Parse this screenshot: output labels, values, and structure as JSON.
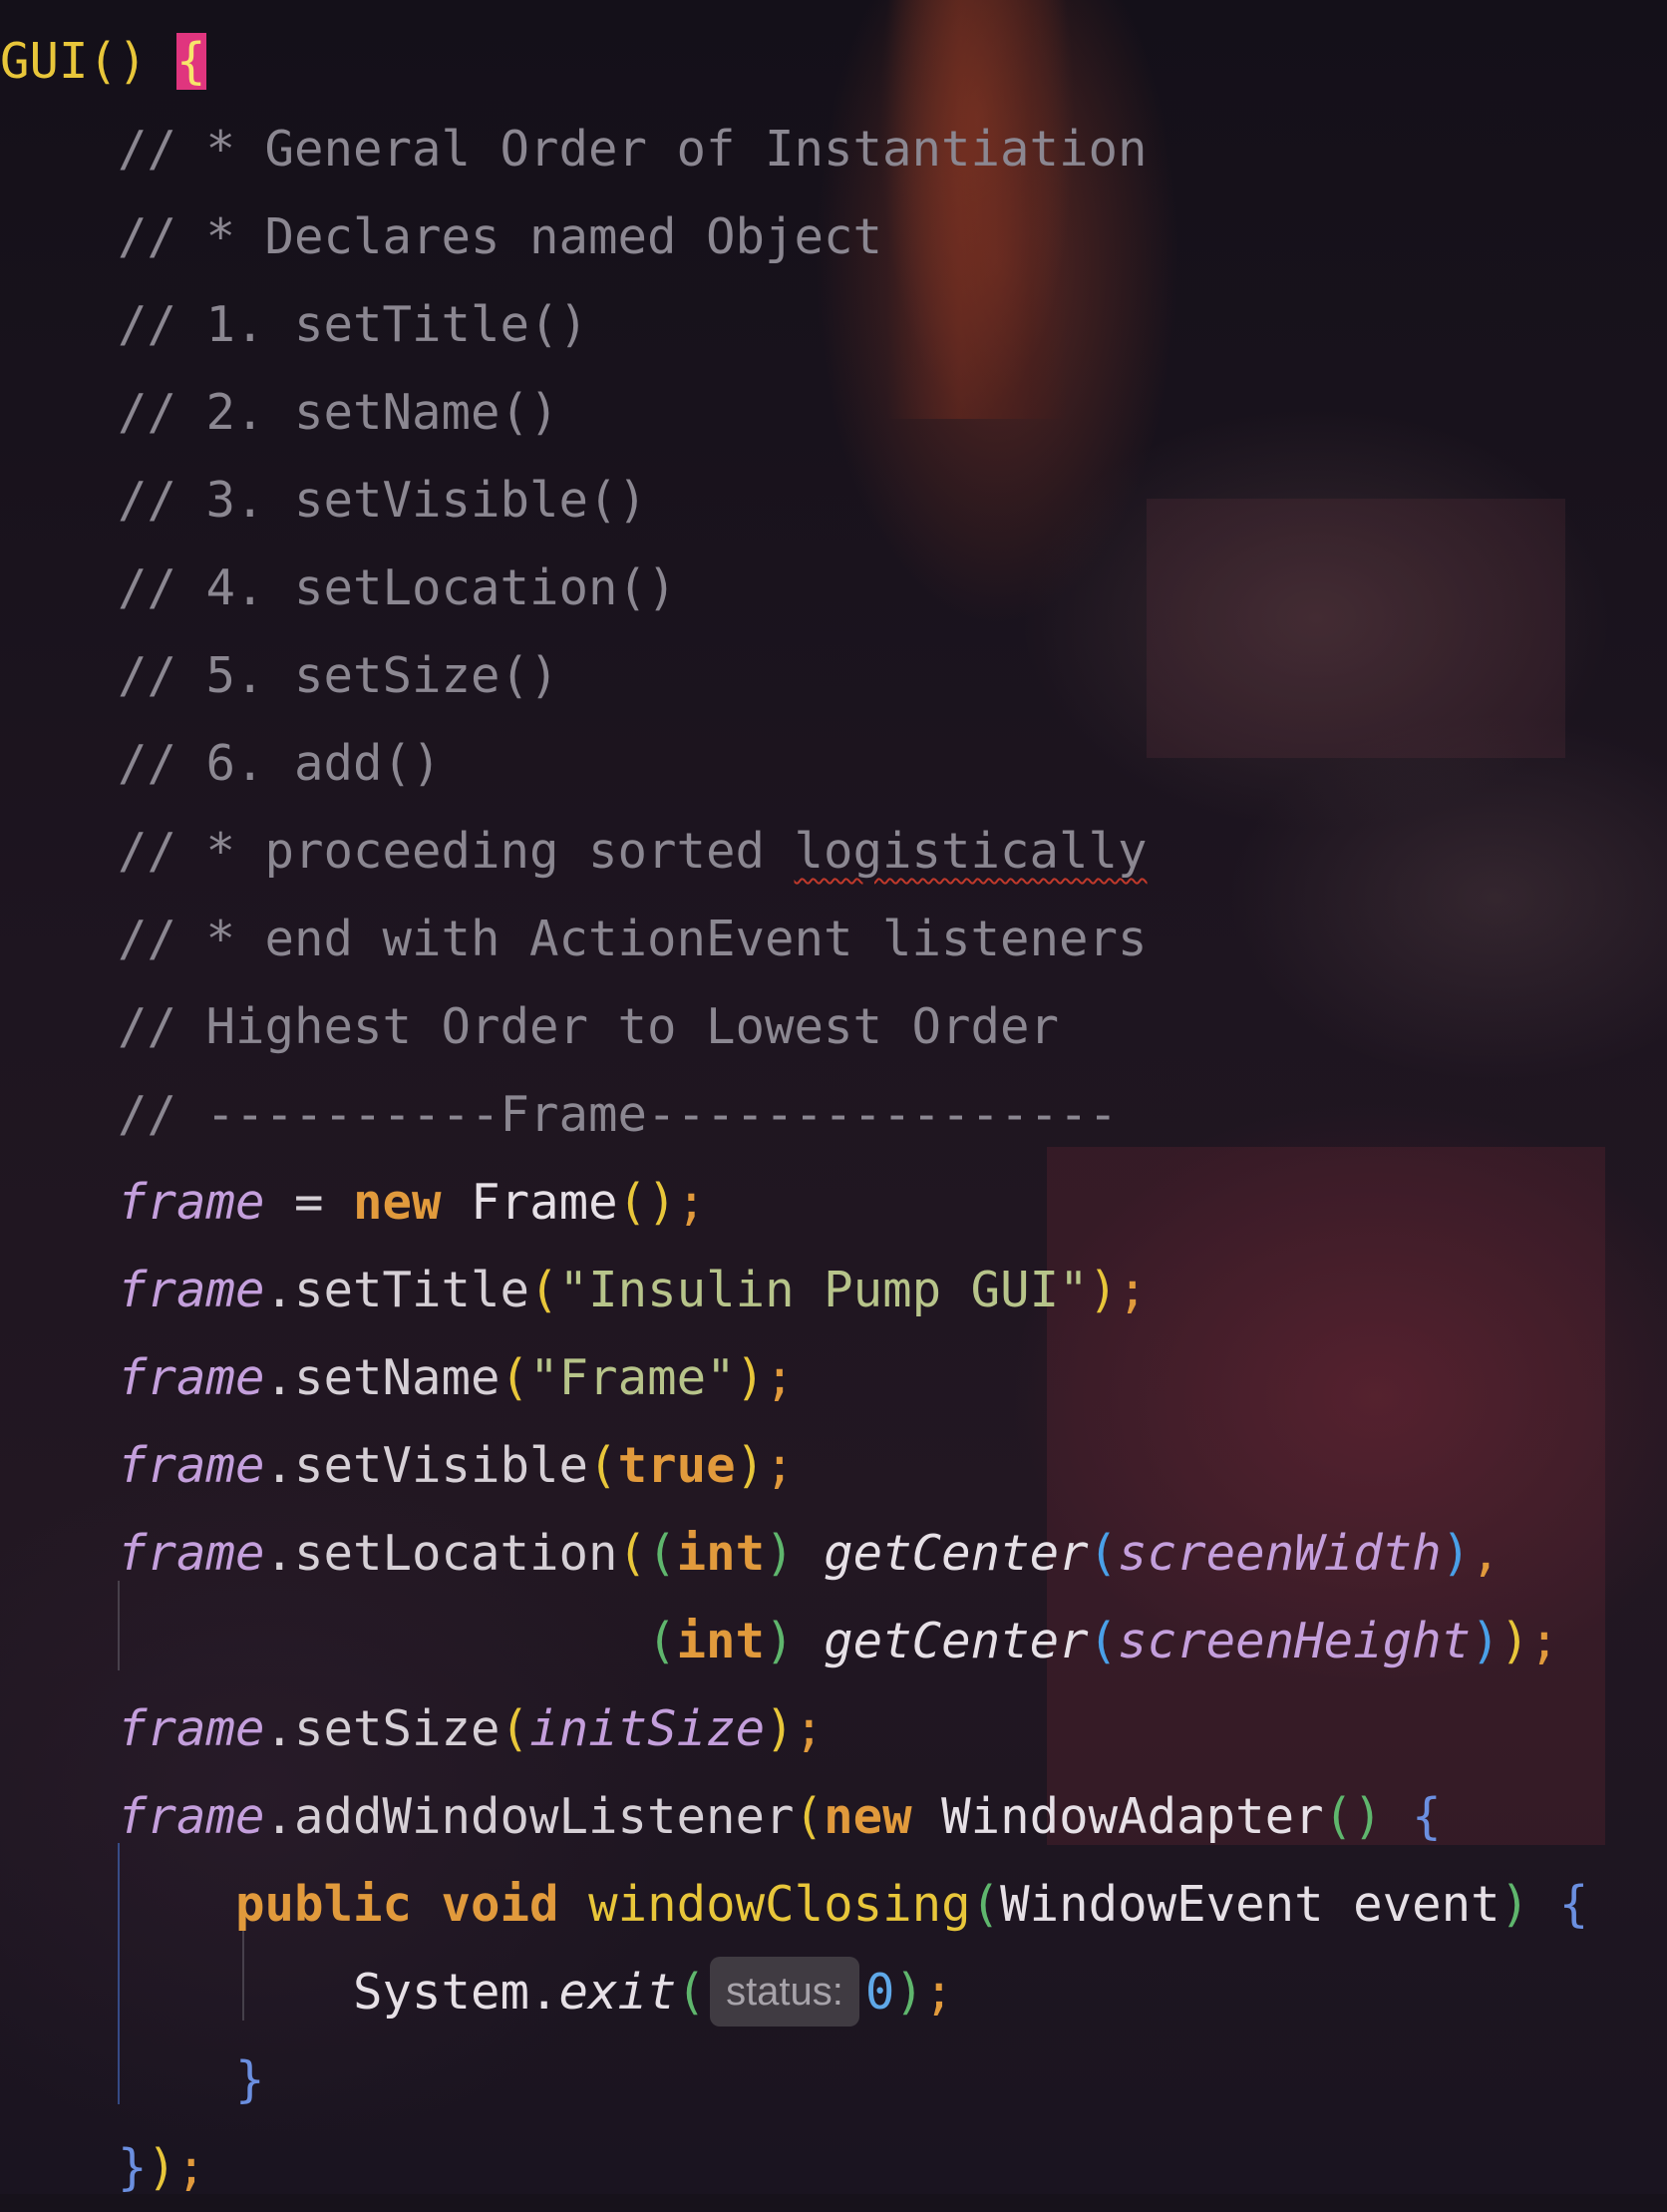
{
  "code": {
    "header": "GUI()",
    "open_brace": "{",
    "comments": [
      "// * General Order of Instantiation",
      "// * Declares named Object",
      "// 1. setTitle()",
      "// 2. setName()",
      "// 3. setVisible()",
      "// 4. setLocation()",
      "// 5. setSize()",
      "// 6. add()",
      "// * proceeding sorted",
      "logistically",
      "// * end with ActionEvent listeners",
      "// Highest Order to Lowest Order",
      "// ----------Frame----------------"
    ],
    "tokens": {
      "frame": "frame",
      "new": "new",
      "Frame": "Frame",
      "setTitle": ".setTitle",
      "title_string": "\"Insulin Pump GUI\"",
      "setName": ".setName",
      "name_string": "\"Frame\"",
      "setVisible": ".setVisible",
      "true": "true",
      "setLocation": ".setLocation",
      "int": "int",
      "getCenter": "getCenter",
      "screenWidth": "screenWidth",
      "screenHeight": "screenHeight",
      "setSize": ".setSize",
      "initSize": "initSize",
      "addWindowListener": ".addWindowListener",
      "WindowAdapter": "WindowAdapter",
      "public": "public",
      "void": "void",
      "windowClosing": "windowClosing",
      "WindowEvent": "WindowEvent",
      "event": "event",
      "System": "System.",
      "exit": "exit",
      "status_hint": "status:",
      "zero": "0"
    }
  }
}
